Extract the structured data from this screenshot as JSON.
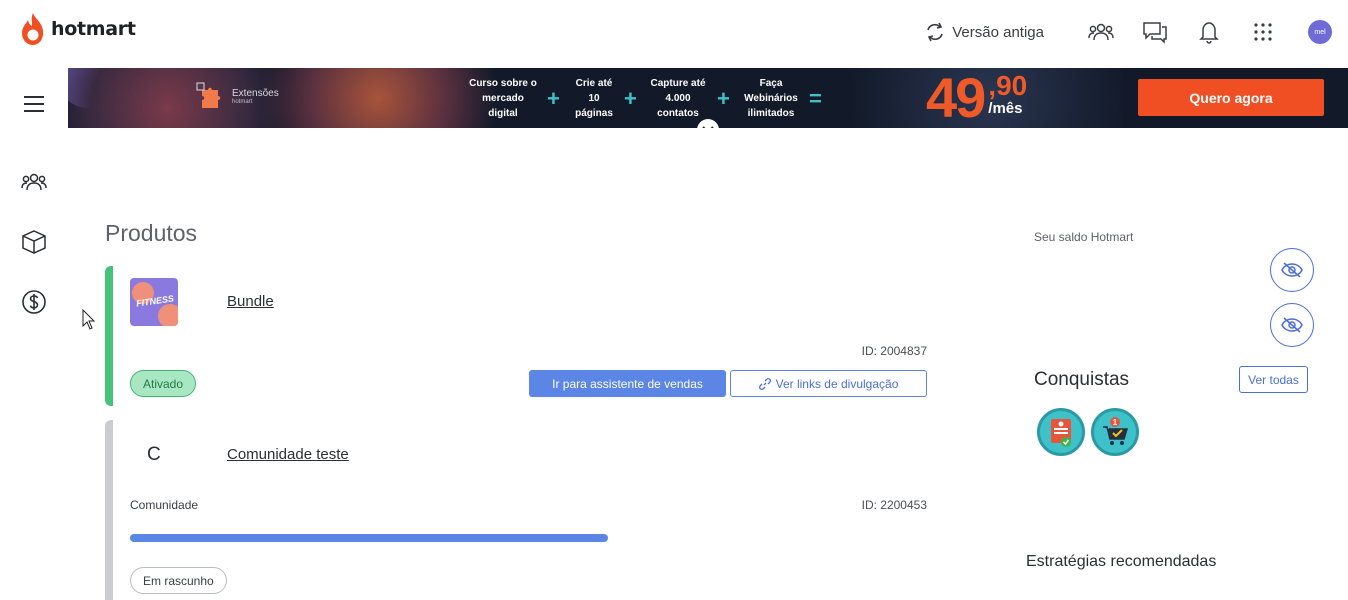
{
  "header": {
    "brand": "hotmart",
    "legacy_label": "Versão antiga",
    "icons": [
      "people-icon",
      "chat-icon",
      "bell-icon",
      "apps-grid-icon"
    ],
    "avatar_text": "mel"
  },
  "sidebar": {
    "items": [
      "menu-icon",
      "people-icon",
      "box-icon",
      "dollar-icon"
    ]
  },
  "banner": {
    "ext_label": "Extensões",
    "ext_sub": "hotmart",
    "features": [
      {
        "line1": "Curso sobre o",
        "line2": "mercado",
        "line3": "digital"
      },
      {
        "line1": "Crie até",
        "line2": "10",
        "line3": "páginas"
      },
      {
        "line1": "Capture até",
        "line2": "4.000",
        "line3": "contatos"
      },
      {
        "line1": "Faça",
        "line2": "Webinários",
        "line3": "ilimitados"
      }
    ],
    "plus": "+",
    "equals": "=",
    "price_main": "49",
    "price_cents": ",90",
    "price_per": "/mês",
    "cta_label": "Quero agora",
    "colors": {
      "accent": "#f04e23",
      "bg": "#121a2a",
      "plus": "#3ec1c8"
    }
  },
  "products": {
    "title": "Produtos",
    "items": [
      {
        "thumb_text": "FITNESS",
        "name": "Bundle",
        "id_label": "ID: 2004837",
        "status": "Ativado",
        "primary_action": "Ir para assistente de vendas",
        "secondary_action": "Ver links de divulgação"
      },
      {
        "letter": "C",
        "name": "Comunidade teste",
        "type": "Comunidade",
        "id_label": "ID: 2200453",
        "progress": 1.0,
        "status": "Em rascunho"
      }
    ]
  },
  "right_panel": {
    "balance_label": "Seu saldo Hotmart",
    "achievements_title": "Conquistas",
    "see_all": "Ver todas",
    "strategies_title": "Estratégias recomendadas"
  }
}
